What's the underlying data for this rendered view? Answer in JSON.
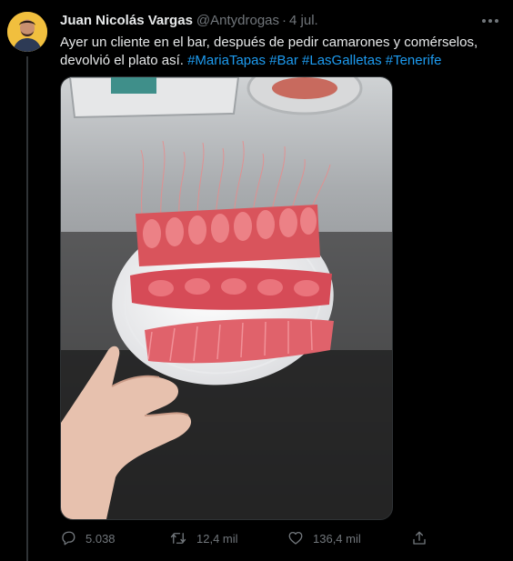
{
  "tweet": {
    "author_name": "Juan Nicolás Vargas",
    "author_handle": "@Antydrogas",
    "separator": "·",
    "date": "4 jul.",
    "text_part1": "Ayer un cliente en el bar, después de pedir camarones y comérselos, devolvió el plato así.",
    "hashtags": [
      "#MariaTapas",
      "#Bar",
      "#LasGalletas",
      "#Tenerife"
    ]
  },
  "actions": {
    "replies": "5.038",
    "retweets": "12,4 mil",
    "likes": "136,4 mil"
  },
  "icons": {
    "more": "more-icon",
    "reply": "reply-icon",
    "retweet": "retweet-icon",
    "like": "heart-icon",
    "share": "share-icon"
  },
  "colors": {
    "background": "#000000",
    "text": "#e7e9ea",
    "secondary": "#71767b",
    "link": "#1d9bf0"
  }
}
